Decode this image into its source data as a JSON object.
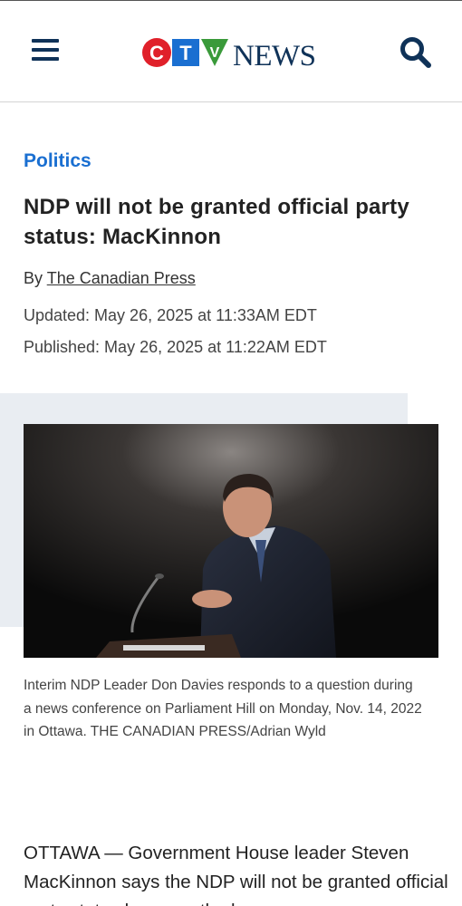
{
  "header": {
    "logo_text": "CTV NEWS",
    "menu_icon": "hamburger-menu-icon",
    "search_icon": "search-icon",
    "brand_colors": {
      "c": "#e0202a",
      "t": "#1a6fd1",
      "v": "#3a9a3a",
      "news": "#0f3258"
    }
  },
  "article": {
    "category": "Politics",
    "headline": "NDP will not be granted official party status: MacKinnon",
    "byline_prefix": "By",
    "author": "The Canadian Press",
    "updated": "Updated: May 26, 2025 at 11:33AM EDT",
    "published": "Published: May 26, 2025 at 11:22AM EDT",
    "caption": "Interim NDP Leader Don Davies responds to a question during a news conference on Parliament Hill on Monday, Nov. 14, 2022 in Ottawa. THE CANADIAN PRESS/Adrian Wyld",
    "body_start": "OTTAWA — Government House leader Steven MacKinnon says the NDP will not be granted official party status because the law..."
  },
  "colors": {
    "accent": "#1a6fd1",
    "nav": "#0f3258",
    "photo_bg_block": "#e9edf2"
  }
}
